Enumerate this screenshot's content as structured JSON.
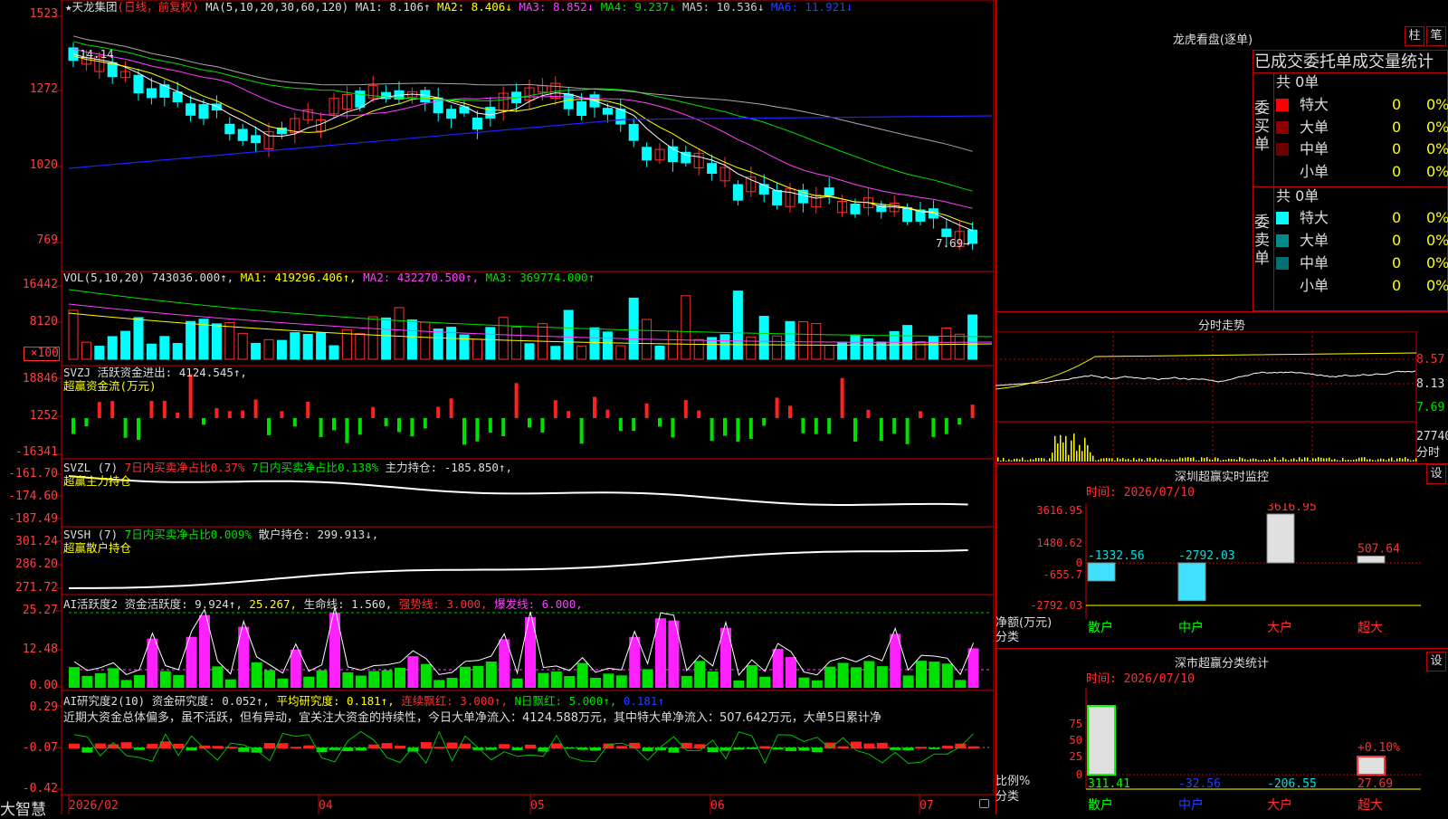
{
  "app_brand": "大智慧",
  "stock": {
    "star": "★",
    "name": "天龙集团",
    "period": "(日线，前复权)"
  },
  "ma_header": {
    "label": "MA(5,10,20,30,60,120)",
    "ma1": "MA1: 8.106↑",
    "ma2": "MA2: 8.406↓",
    "ma3": "MA3: 8.852↓",
    "ma4": "MA4: 9.237↓",
    "ma5": "MA5: 10.536↓",
    "ma6": "MA6: 11.921↓"
  },
  "price_axis": [
    "1523",
    "1272",
    "1020",
    "769"
  ],
  "price_annot_high": "14.14",
  "price_annot_low": "7.69→",
  "vol_header": {
    "label": "VOL(5,10,20)",
    "vol": "743036.000↑,",
    "ma1": "MA1: 419296.406↑,",
    "ma2": "MA2: 432270.500↑,",
    "ma3": "MA3: 369774.000↑"
  },
  "vol_axis": [
    "16442",
    "8120",
    "×100"
  ],
  "svzj": {
    "label": "SVZJ",
    "value": "活跃资金进出: 4124.545↑,",
    "sub": "超赢资金流(万元)",
    "axis": [
      "18846",
      "1252",
      "-16341"
    ]
  },
  "svzl": {
    "label": "SVZL (7)",
    "buy": "7日内买卖净占比0.37%",
    "buy2": "7日内买卖净占比0.138%",
    "hold": "主力持仓: -185.850↑,",
    "sub": "超赢主力持仓",
    "axis": [
      "-161.70",
      "-174.60",
      "-187.49"
    ]
  },
  "svsh": {
    "label": "SVSH (7)",
    "buy": "7日内买卖净占比0.009%",
    "hold": "散户持仓: 299.913↓,",
    "sub": "超赢散户持仓",
    "axis": [
      "301.24",
      "286.20",
      "271.72"
    ]
  },
  "ai_active": {
    "label": "AI活跃度2",
    "fund": "资金活跃度: 9.924↑,",
    "v2": "25.267,",
    "life": "生命线: 1.560,",
    "strong": "强势线: 3.000,",
    "burst": "爆发线: 6.000,",
    "axis": [
      "25.27",
      "12.48",
      "0.00"
    ]
  },
  "ai_research": {
    "label": "AI研究度2(10)",
    "fund": "资金研究度: 0.052↑,",
    "avg": "平均研究度: 0.181↑,",
    "cont": "连续飘红: 3.000↑,",
    "nday": "N日飘红: 5.000↑,",
    "last": "0.181↑",
    "axis": [
      "0.29",
      "-0.07",
      "-0.42"
    ],
    "comment": "近期大资金总体偏多，虽不活跃，但有异动，宜关注大资金的持续性，今日大单净流入：4124.588万元，其中特大单净流入：507.642万元，大单5日累计净"
  },
  "x_axis": [
    "2026/02",
    "04",
    "05",
    "06",
    "07"
  ],
  "right": {
    "lhb_title": "龙虎看盘(逐单)",
    "btn1": "柱",
    "btn2": "笔",
    "order_title": "已成交委托单成交量统计",
    "buy_label": "委买单",
    "sell_label": "委卖单",
    "buy_total": "共 0单",
    "sell_total": "共 0单",
    "rows_buy": [
      {
        "name": "特大",
        "count": "0",
        "pct": "0%",
        "color": "#ff0000"
      },
      {
        "name": "大单",
        "count": "0",
        "pct": "0%",
        "color": "#8b0000"
      },
      {
        "name": "中单",
        "count": "0",
        "pct": "0%",
        "color": "#6b0000"
      },
      {
        "name": "小单",
        "count": "0",
        "pct": "0%",
        "color": ""
      }
    ],
    "rows_sell": [
      {
        "name": "特大",
        "count": "0",
        "pct": "0%",
        "color": "#00ffff"
      },
      {
        "name": "大单",
        "count": "0",
        "pct": "0%",
        "color": "#008b8b"
      },
      {
        "name": "中单",
        "count": "0",
        "pct": "0%",
        "color": "#007070"
      },
      {
        "name": "小单",
        "count": "0",
        "pct": "0%",
        "color": ""
      }
    ],
    "intraday_title": "分时走势",
    "intraday_axis": [
      "8.57",
      "8.13",
      "7.69"
    ],
    "intraday_vol": "27740",
    "intraday_vol_label": "分时",
    "monitor_title": "深圳超赢实时监控",
    "settings": "设",
    "monitor_time": "时间: 2026/07/10",
    "monitor_axis": [
      "3616.95",
      "1480.62",
      "0",
      "-655.7",
      "-2792.03"
    ],
    "monitor_unit": "净额(万元)",
    "monitor_cat_label": "分类",
    "monitor_bars": [
      {
        "name": "散户",
        "value": -1332.56,
        "label": "-1332.56"
      },
      {
        "name": "中户",
        "value": -2792.03,
        "label": "-2792.03"
      },
      {
        "name": "大户",
        "value": 3616.95,
        "label": "3616.95"
      },
      {
        "name": "超大",
        "value": 507.64,
        "label": "507.64"
      }
    ],
    "classify_title": "深市超赢分类统计",
    "classify_time": "时间: 2026/07/10",
    "classify_axis": [
      "75",
      "50",
      "25",
      "0"
    ],
    "classify_unit": "比例%",
    "classify_cat_label": "分类",
    "classify_pct": "+0.10%",
    "classify_bars": [
      {
        "name": "散户",
        "value": 311.41,
        "label": "311.41"
      },
      {
        "name": "中户",
        "value": -32.56,
        "label": "-32.56"
      },
      {
        "name": "大户",
        "value": -206.55,
        "label": "-206.55"
      },
      {
        "name": "超大",
        "value": 27.69,
        "label": "27.69"
      }
    ]
  }
}
